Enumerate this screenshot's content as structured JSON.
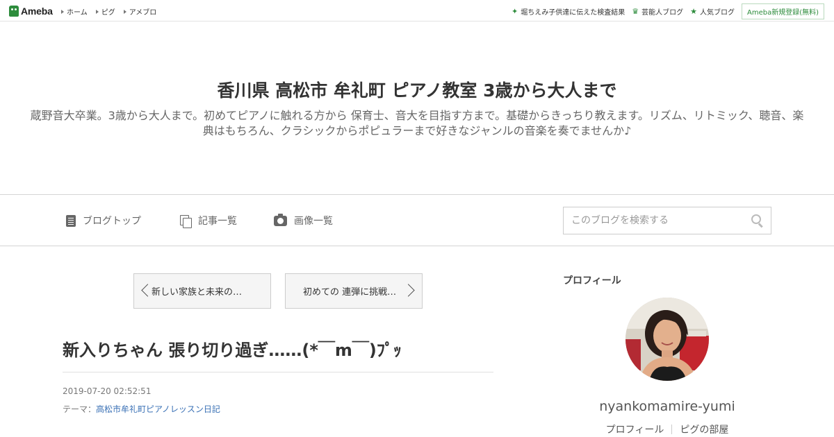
{
  "topbar": {
    "logo": "Ameba",
    "nav": [
      {
        "label": "ホーム"
      },
      {
        "label": "ピグ"
      },
      {
        "label": "アメブロ"
      }
    ],
    "right": [
      {
        "label": "堀ちえみ子供達に伝えた検査結果",
        "icon": "sparkle-icon"
      },
      {
        "label": "芸能人ブログ",
        "icon": "crown-icon"
      },
      {
        "label": "人気ブログ",
        "icon": "star-icon"
      }
    ],
    "register_label": "Ameba新規登録(無料)"
  },
  "header": {
    "title": "香川県 高松市 牟礼町 ピアノ教室 3歳から大人まで",
    "description": "蔵野音大卒業。3歳から大人まで。初めてピアノに触れる方から 保育士、音大を目指す方まで。基礎からきっちり教えます。リズム、リトミック、聴音、楽典はもちろん、クラシックからポピュラーまで好きなジャンルの音楽を奏でませんか♪"
  },
  "nav": {
    "items": [
      {
        "label": "ブログトップ",
        "icon": "document-icon"
      },
      {
        "label": "記事一覧",
        "icon": "pages-icon"
      },
      {
        "label": "画像一覧",
        "icon": "camera-icon"
      }
    ],
    "search_placeholder": "このブログを検索する"
  },
  "entry": {
    "prev_label": "新しい家族と未来の…",
    "next_label": "初めての 連弾に挑戦…",
    "title": "新入りちゃん 張り切り過ぎ……(*￣m￣)ﾌﾟｯ",
    "date": "2019-07-20 02:52:51",
    "theme_prefix": "テーマ：",
    "theme": "高松市牟礼町ピアノレッスン日記"
  },
  "sidebar": {
    "heading": "プロフィール",
    "username": "nyankomamire-yumi",
    "links": [
      {
        "label": "プロフィール"
      },
      {
        "label": "ピグの部屋"
      }
    ]
  },
  "colors": {
    "accent_green": "#2d8c3c",
    "link_blue": "#3970b5"
  }
}
